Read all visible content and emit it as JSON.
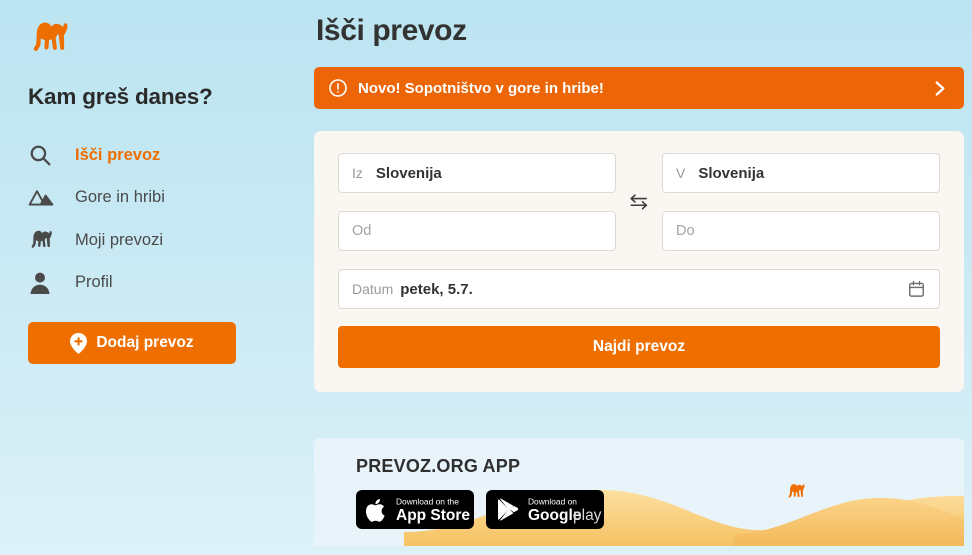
{
  "brand": {
    "logo_icon": "camel-logo-icon",
    "accent_color": "#ee6f00",
    "banner_color": "#ec6608",
    "page_bg_color": "#c8e9f4",
    "card_bg_color": "#faf6f1"
  },
  "sidebar": {
    "tagline": "Kam greš danes?",
    "items": [
      {
        "label": "Išči prevoz",
        "icon": "search-icon",
        "active": true
      },
      {
        "label": "Gore in hribi",
        "icon": "mountain-icon",
        "active": false
      },
      {
        "label": "Moji prevozi",
        "icon": "camel-icon",
        "active": false
      },
      {
        "label": "Profil",
        "icon": "person-icon",
        "active": false
      }
    ],
    "add_button": {
      "label": "Dodaj prevoz",
      "icon": "map-pin-plus-icon"
    }
  },
  "main": {
    "page_title": "Išči prevoz",
    "banner": {
      "icon": "exclamation-circle-icon",
      "text": "Novo! Sopotništvo v gore in hribe!",
      "chevron_icon": "chevron-right-icon"
    },
    "search_form": {
      "from": {
        "prefix": "Iz",
        "value": "Slovenija"
      },
      "to": {
        "prefix": "V",
        "value": "Slovenija"
      },
      "from_detail": {
        "placeholder": "Od",
        "value": ""
      },
      "to_detail": {
        "placeholder": "Do",
        "value": ""
      },
      "swap_icon": "swap-arrows-icon",
      "date": {
        "prefix": "Datum",
        "value": "petek, 5.7.",
        "icon": "calendar-icon"
      },
      "submit_label": "Najdi prevoz"
    },
    "app_promo": {
      "title": "PREVOZ.ORG APP",
      "badges": [
        {
          "name": "app-store-badge",
          "line1": "Download on the",
          "line2": "App Store",
          "icon": "apple-icon"
        },
        {
          "name": "google-play-badge",
          "line1": "Download on",
          "line2_a": "Google",
          "line2_b": "play",
          "icon": "google-play-icon"
        }
      ],
      "illustration": "desert-dunes-camel-illustration"
    }
  }
}
